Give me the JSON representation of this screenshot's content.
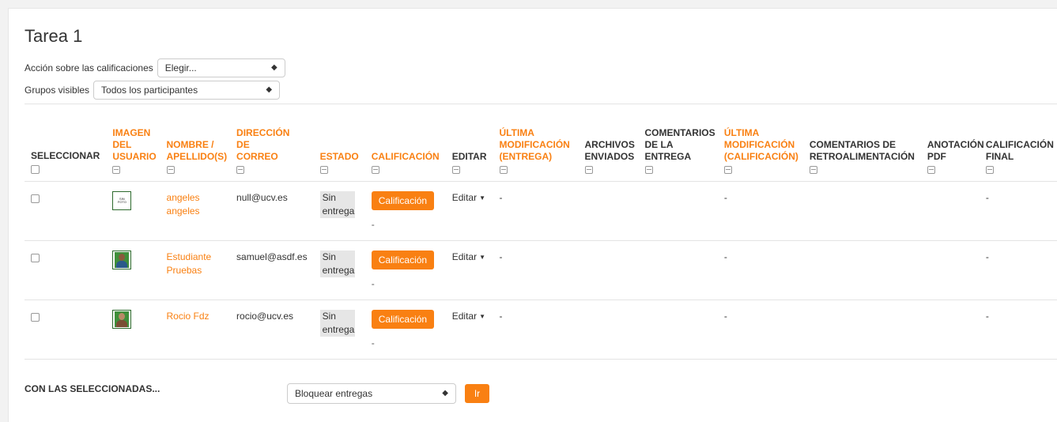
{
  "page": {
    "title": "Tarea 1"
  },
  "controls": {
    "grading_action_label": "Acción sobre las calificaciones",
    "grading_action_value": "Elegir...",
    "groups_label": "Grupos visibles",
    "groups_value": "Todos los participantes"
  },
  "table": {
    "headers": [
      "SELECCIONAR",
      "IMAGEN DEL USUARIO",
      "NOMBRE / APELLIDO(S)",
      "DIRECCIÓN DE CORREO",
      "ESTADO",
      "CALIFICACIÓN",
      "EDITAR",
      "ÚLTIMA MODIFICACIÓN (ENTREGA)",
      "ARCHIVOS ENVIADOS",
      "COMENTARIOS DE LA ENTREGA",
      "ÚLTIMA MODIFICACIÓN (CALIFICACIÓN)",
      "COMENTARIOS DE RETROALIMENTACIÓN",
      "ANOTACIÓN PDF",
      "CALIFICACIÓN FINAL"
    ],
    "rows": [
      {
        "name": "angeles angeles",
        "email": "null@ucv.es",
        "estado": "Sin entrega",
        "grade_button": "Calificación",
        "grade_dash": "-",
        "editar": "Editar",
        "last_mod_submission": "-",
        "last_mod_grade": "-",
        "final_grade": "-",
        "avatar": "no-photo"
      },
      {
        "name": "Estudiante Pruebas",
        "email": "samuel@asdf.es",
        "estado": "Sin entrega",
        "grade_button": "Calificación",
        "grade_dash": "-",
        "editar": "Editar",
        "last_mod_submission": "-",
        "last_mod_grade": "-",
        "final_grade": "-",
        "avatar": "male-photo"
      },
      {
        "name": "Rocio Fdz",
        "email": "rocio@ucv.es",
        "estado": "Sin entrega",
        "grade_button": "Calificación",
        "grade_dash": "-",
        "editar": "Editar",
        "last_mod_submission": "-",
        "last_mod_grade": "-",
        "final_grade": "-",
        "avatar": "female-photo"
      }
    ]
  },
  "bulk": {
    "label": "CON LAS SELECCIONADAS...",
    "select_value": "Bloquear entregas",
    "go_button": "Ir"
  },
  "colors": {
    "accent": "#f98012",
    "estado_bg": "#e6e6e6"
  }
}
